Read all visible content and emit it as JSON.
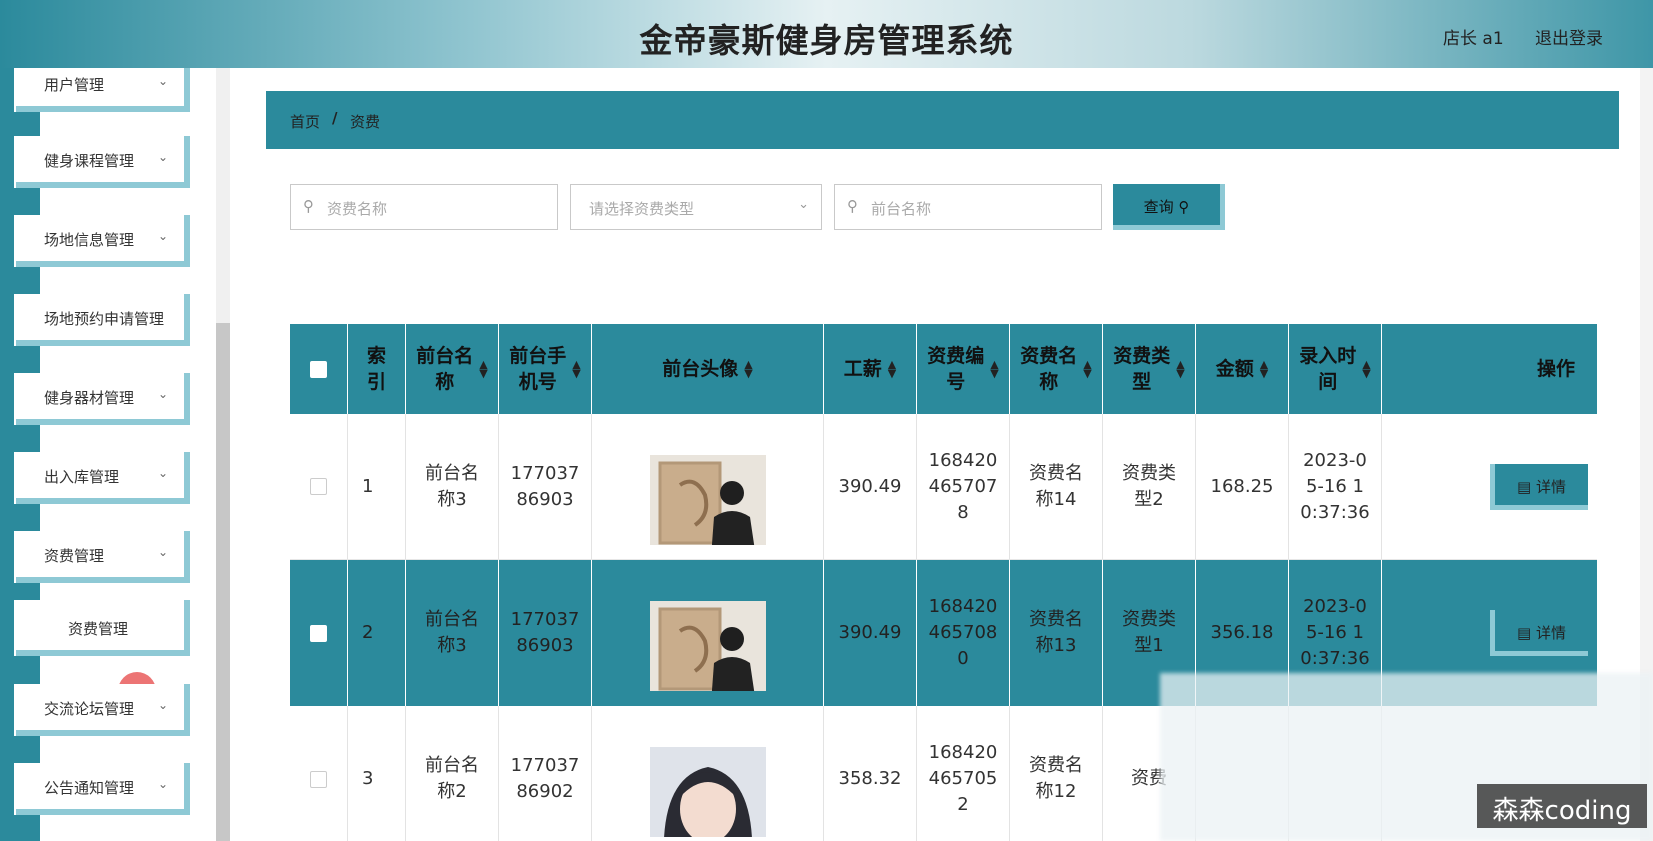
{
  "header": {
    "title": "金帝豪斯健身房管理系统",
    "user": "店长 a1",
    "logout": "退出登录"
  },
  "sidebar": {
    "items": [
      {
        "label": "用户管理"
      },
      {
        "label": "健身课程管理"
      },
      {
        "label": "场地信息管理"
      },
      {
        "label": "场地预约申请管理"
      },
      {
        "label": "健身器材管理"
      },
      {
        "label": "出入库管理"
      },
      {
        "label": "资费管理"
      },
      {
        "label": "交流论坛管理"
      },
      {
        "label": "公告通知管理"
      }
    ],
    "sub_item": "资费管理"
  },
  "breadcrumb": {
    "home": "首页",
    "sep": "/",
    "current": "资费"
  },
  "search": {
    "name_placeholder": "资费名称",
    "type_placeholder": "请选择资费类型",
    "desk_placeholder": "前台名称",
    "query": "查询"
  },
  "table": {
    "headers": [
      "索\n引",
      "前台名\n称",
      "前台手\n机号",
      "前台头像",
      "工薪",
      "资费编\n号",
      "资费名\n称",
      "资费类\n型",
      "金额",
      "录入时\n间",
      "操作"
    ],
    "rows": [
      {
        "index": "1",
        "desk_name": "前台名\n称3",
        "phone": "177037\n86903",
        "salary": "390.49",
        "fee_no": "168420\n465707\n8",
        "fee_name": "资费名\n称14",
        "fee_type": "资费类\n型2",
        "amount": "168.25",
        "time": "2023-0\n5-16 1\n0:37:36",
        "action": "详情"
      },
      {
        "index": "2",
        "desk_name": "前台名\n称3",
        "phone": "177037\n86903",
        "salary": "390.49",
        "fee_no": "168420\n465708\n0",
        "fee_name": "资费名\n称13",
        "fee_type": "资费类\n型1",
        "amount": "356.18",
        "time": "2023-0\n5-16 1\n0:37:36",
        "action": "详情"
      },
      {
        "index": "3",
        "desk_name": "前台名\n称2",
        "phone": "177037\n86902",
        "salary": "358.32",
        "fee_no": "168420\n465705\n2",
        "fee_name": "资费名\n称12",
        "fee_type": "资费",
        "amount": "",
        "time": "",
        "action": ""
      }
    ]
  },
  "watermark": "森森coding",
  "colors": {
    "primary": "#2b8a9c",
    "accent": "#8ec9d5"
  }
}
